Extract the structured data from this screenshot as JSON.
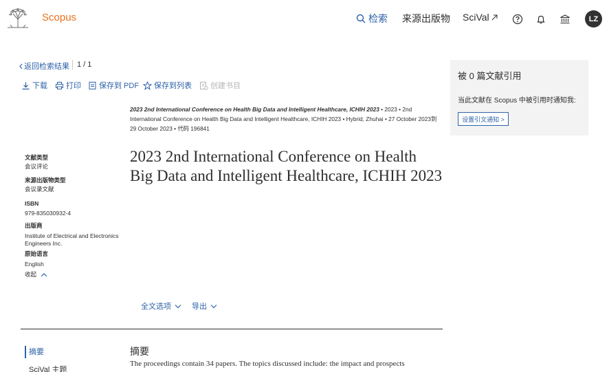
{
  "header": {
    "brand": "Scopus",
    "nav": {
      "search": "检索",
      "sources": "来源出版物",
      "scival": "SciVal"
    },
    "avatar_initials": "LZ"
  },
  "toolbar": {
    "back": "返回检索结果",
    "pager": "1 / 1",
    "download": "下载",
    "print": "打印",
    "save_pdf": "保存到 PDF",
    "save_list": "保存到列表",
    "create_bib": "创建书目"
  },
  "cited_by": {
    "title": "被 0 篇文献引用",
    "text": "当此文献在 Scopus 中被引用时通知我:",
    "button": "设置引文通知 >"
  },
  "source": {
    "title": "2023 2nd International Conference on Health Big Data and Intelligent Healthcare, ICHIH 2023",
    "rest": " • 2023 • 2nd International Conference on Health Big Data and Intelligent Healthcare, ICHIH 2023 • Hybrid, Zhuhai • 27 October 2023到 29 October 2023 • 代码 196841"
  },
  "metadata": {
    "doc_type_label": "文献类型",
    "doc_type": "会议评论",
    "source_type_label": "来源出版物类型",
    "source_type": "会议录文献",
    "isbn_label": "ISBN",
    "isbn": "979-835030932-4",
    "publisher_label": "出版商",
    "publisher": "Institute of Electrical and Electronics Engineers Inc.",
    "language_label": "原始语言",
    "language": "English",
    "collapse": "收起"
  },
  "document": {
    "title": "2023 2nd International Conference on Health Big Data and Intelligent Healthcare, ICHIH 2023",
    "fulltext": "全文选项",
    "export": "导出"
  },
  "sidenav": {
    "abstract": "摘要",
    "scival_topic": "SciVal 主题"
  },
  "abstract": {
    "heading": "摘要",
    "text": "The proceedings contain 34 papers. The topics discussed include: the impact and prospects"
  }
}
